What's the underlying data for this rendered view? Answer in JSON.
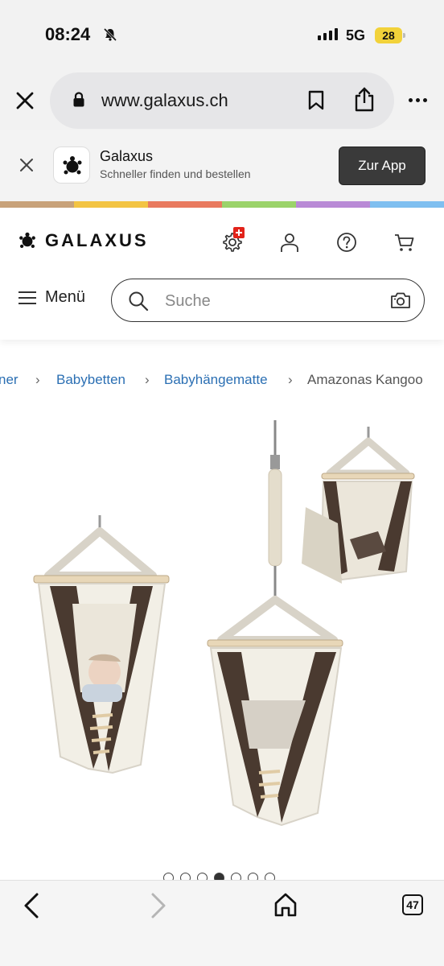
{
  "status_bar": {
    "time": "08:24",
    "network": "5G",
    "battery": "28"
  },
  "browser": {
    "url": "www.galaxus.ch"
  },
  "app_banner": {
    "app_name": "Galaxus",
    "tagline": "Schneller finden und bestellen",
    "button_label": "Zur App"
  },
  "rainbow_colors": [
    "#c8a27a",
    "#f3c443",
    "#e97a5f",
    "#9bd36a",
    "#b98ad6",
    "#7fbff0"
  ],
  "header": {
    "logo_text": "GALAXUS",
    "menu_label": "Menü",
    "search_placeholder": "Suche"
  },
  "breadcrumb": {
    "items": [
      "ner",
      "Babybetten",
      "Babyhängematte"
    ],
    "current": "Amazonas Kangoo"
  },
  "carousel": {
    "total": 7,
    "active_index": 3
  },
  "bottom_bar": {
    "tab_count": "47"
  }
}
